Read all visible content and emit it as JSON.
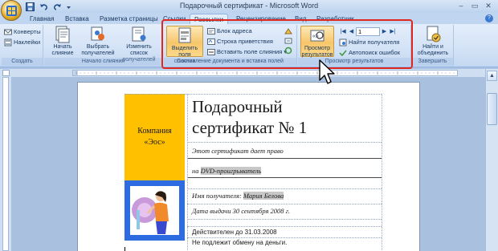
{
  "window": {
    "title": "Подарочный сертификат - Microsoft Word",
    "controls": {
      "minimize": "–",
      "maximize": "▭",
      "close": "✕"
    }
  },
  "qat": {
    "icons": [
      "save-icon",
      "undo-icon",
      "redo-icon",
      "dropdown-icon"
    ]
  },
  "tabs": [
    {
      "label": "Главная",
      "active": false
    },
    {
      "label": "Вставка",
      "active": false
    },
    {
      "label": "Разметка страницы",
      "active": false
    },
    {
      "label": "Ссылки",
      "active": false
    },
    {
      "label": "Рассылки",
      "active": true
    },
    {
      "label": "Рецензирование",
      "active": false
    },
    {
      "label": "Вид",
      "active": false
    },
    {
      "label": "Разработчик",
      "active": false
    }
  ],
  "ribbon": {
    "groups": {
      "create": {
        "label": "Создать",
        "envelopes": "Конверты",
        "labels": "Наклейки"
      },
      "start_merge": {
        "label": "Начало слияния",
        "start": "Начать слияние",
        "select": "Выбрать получателей",
        "edit_list": "Изменить список получателей"
      },
      "write_insert": {
        "label": "Составление документа и вставка полей",
        "highlight": "Выделить поля слияния",
        "address_block": "Блок адреса",
        "greeting_line": "Строка приветствия",
        "insert_field": "Вставить поле слияния"
      },
      "preview": {
        "label": "Просмотр результатов",
        "preview_btn": "Просмотр результатов",
        "record_number": "1",
        "find_recipient": "Найти получателя",
        "auto_check": "Автопоиск ошибок"
      },
      "finish": {
        "label": "Завершить",
        "finish_merge": "Найти и объединить"
      }
    }
  },
  "document": {
    "company": "Компания «Эос»",
    "cert_title_line1": "Подарочный",
    "cert_title_line2": "сертификат № 1",
    "gives_right": "Этот сертификат дает право",
    "on_prefix": "на",
    "product_field": "DVD-проигрыватель",
    "recipient_label": "Имя получателя:",
    "recipient_field": "Мария Белова",
    "issue_date": "Дата выдачи 30 сентября 2008 г.",
    "valid_until": "Действителен до 31.03.2008",
    "no_exchange": "Не подлежит обмену на деньги."
  },
  "colors": {
    "accent_ribbon_frame": "#e0271f",
    "company_cell": "#ffc000",
    "picture_cell": "#2d6be0",
    "highlight_button": "#f7c66b"
  }
}
